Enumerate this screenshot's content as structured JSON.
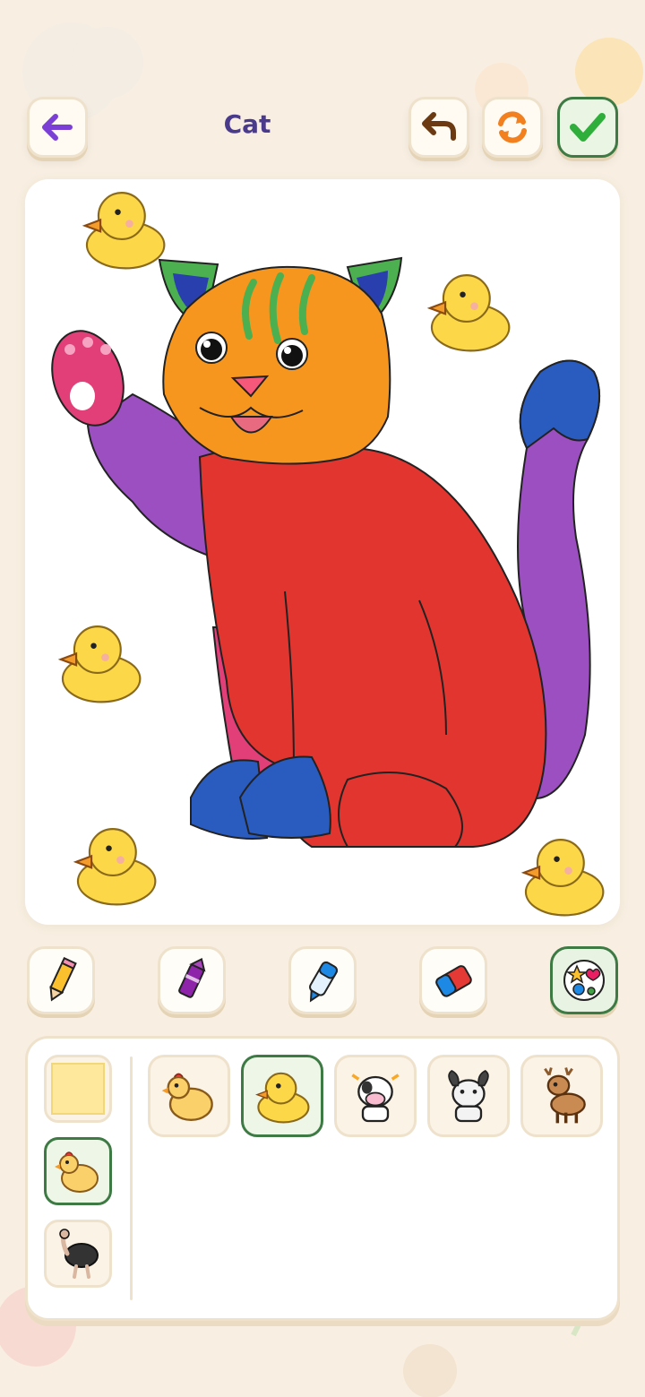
{
  "header": {
    "title": "Cat"
  },
  "toolbar": {
    "buttons": [
      {
        "name": "back",
        "icon": "arrow-left-icon"
      },
      {
        "name": "undo",
        "icon": "undo-icon"
      },
      {
        "name": "reset",
        "icon": "refresh-icon"
      },
      {
        "name": "done",
        "icon": "check-icon"
      }
    ]
  },
  "tools": [
    {
      "name": "pencil",
      "icon": "pencil-icon",
      "active": false
    },
    {
      "name": "crayon",
      "icon": "crayon-icon",
      "active": false
    },
    {
      "name": "marker",
      "icon": "marker-icon",
      "active": false
    },
    {
      "name": "eraser",
      "icon": "eraser-icon",
      "active": false
    },
    {
      "name": "stickers",
      "icon": "sticker-icon",
      "active": true
    }
  ],
  "sticker_categories": [
    {
      "name": "color-swatch",
      "icon": "yellow-swatch-icon",
      "active": false
    },
    {
      "name": "farm",
      "icon": "chicken-icon",
      "active": true
    },
    {
      "name": "birds",
      "icon": "ostrich-icon",
      "active": false
    }
  ],
  "stickers": [
    {
      "name": "chicken",
      "icon": "chicken-icon",
      "active": false
    },
    {
      "name": "duck",
      "icon": "duck-icon",
      "active": true
    },
    {
      "name": "cow",
      "icon": "cow-icon",
      "active": false
    },
    {
      "name": "dog",
      "icon": "dog-icon",
      "active": false
    },
    {
      "name": "deer",
      "icon": "deer-icon",
      "active": false
    }
  ],
  "colors": {
    "background": "#f8efe2",
    "accent_green": "#3d7a44",
    "title_purple": "#4a3a8c",
    "cat_orange": "#f7961e",
    "cat_red": "#e2352f",
    "cat_purple": "#9b4fc1",
    "cat_blue": "#2a5bbf",
    "cat_pink": "#e23f78",
    "ear_green": "#4caf50"
  }
}
